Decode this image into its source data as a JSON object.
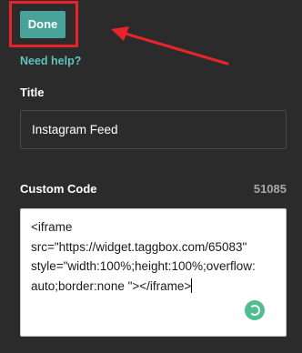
{
  "header": {
    "done_label": "Done"
  },
  "help": {
    "label": "Need help?"
  },
  "title_field": {
    "label": "Title",
    "value": "Instagram Feed"
  },
  "custom_code": {
    "label": "Custom Code",
    "counter": "51085",
    "lines": [
      "<iframe",
      "src=\"https://widget.taggbox.com/65083\"",
      "style=\"width:100%;height:100%;overflow:",
      "auto;border:none \"></iframe>"
    ]
  },
  "annotation": {
    "highlight_color": "#e8232a",
    "arrow_color": "#e8232a"
  },
  "colors": {
    "accent": "#4aa39a",
    "link": "#5ec4bd",
    "background": "#2b2b2b",
    "spinner": "#4fbf8f"
  },
  "icons": {
    "arrow": "red-arrow-annotation",
    "spinner": "loading-spinner-icon"
  }
}
